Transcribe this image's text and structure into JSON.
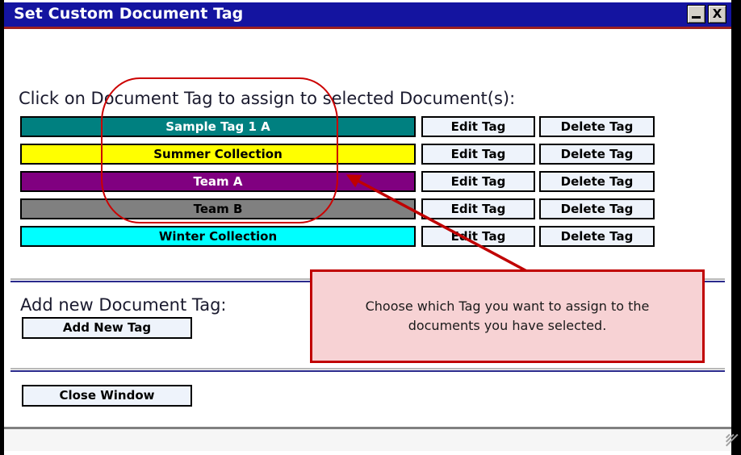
{
  "window": {
    "title": "Set Custom Document Tag",
    "minimize_label": "minimize",
    "close_label": "X",
    "frame_color": "#000000",
    "titlebar_color": "#1414a0"
  },
  "main": {
    "instruction": "Click on Document Tag to assign to selected Document(s):",
    "add_section_label": "Add new Document Tag:",
    "add_button_label": "Add New Tag",
    "close_button_label": "Close Window",
    "edit_button_label": "Edit Tag",
    "delete_button_label": "Delete Tag",
    "tags": [
      {
        "name": "Sample Tag 1 A",
        "color": "#008080",
        "text_color": "#ffffff"
      },
      {
        "name": "Summer Collection",
        "color": "#ffff00",
        "text_color": "#000000"
      },
      {
        "name": "Team A",
        "color": "#800080",
        "text_color": "#ffffff"
      },
      {
        "name": "Team B",
        "color": "#808080",
        "text_color": "#000000"
      },
      {
        "name": "Winter Collection",
        "color": "#00ffff",
        "text_color": "#000000"
      }
    ]
  },
  "annotation": {
    "callout_text": "Choose which Tag you want to assign to the documents you have selected.",
    "callout_fill": "#f7d2d4",
    "callout_border": "#c00000",
    "highlight_color": "#cc0000"
  }
}
